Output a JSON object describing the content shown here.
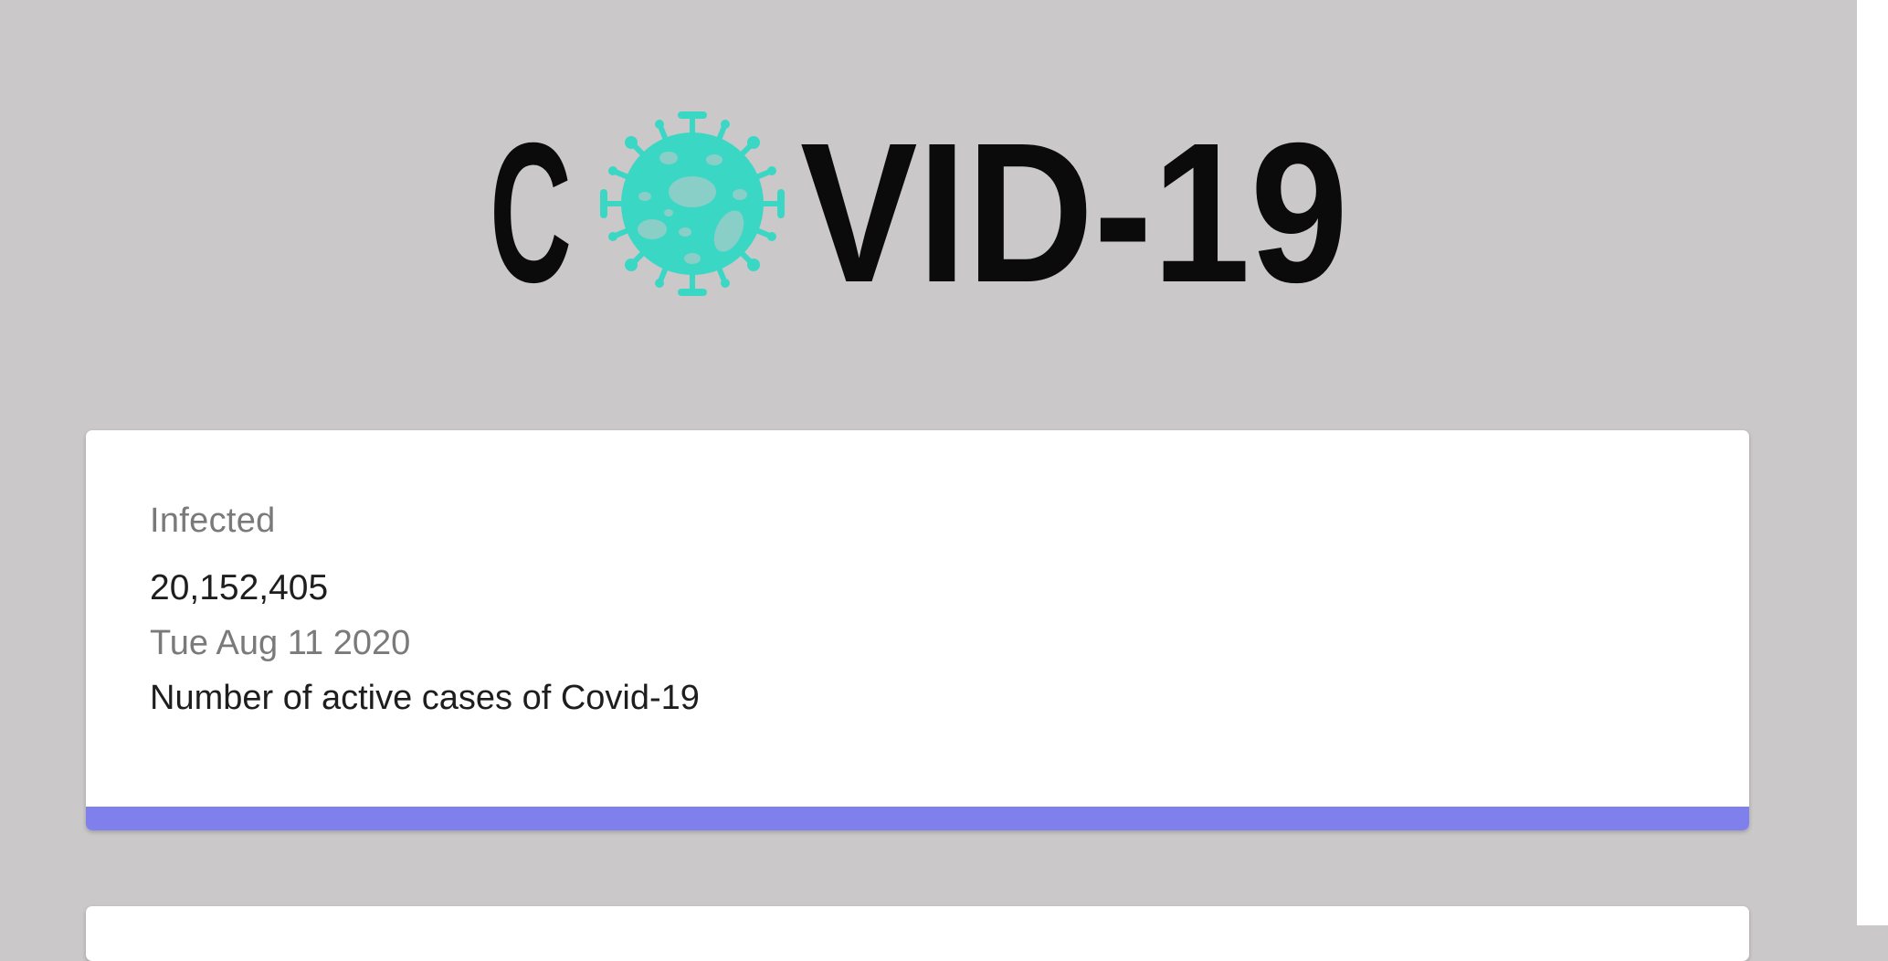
{
  "colors": {
    "background": "#cac8c9",
    "card_background": "#ffffff",
    "infected_accent": "#8080ec",
    "virus_icon": "#3bd7c5",
    "logo_text": "#0a0b0a"
  },
  "logo": {
    "icon": "virus-icon",
    "letter_c": "C",
    "rest": "VID-19"
  },
  "cards": [
    {
      "title": "Infected",
      "value": "20,152,405",
      "date": "Tue Aug 11 2020",
      "description": "Number of active cases of Covid-19",
      "accent": "#8080ec"
    }
  ]
}
